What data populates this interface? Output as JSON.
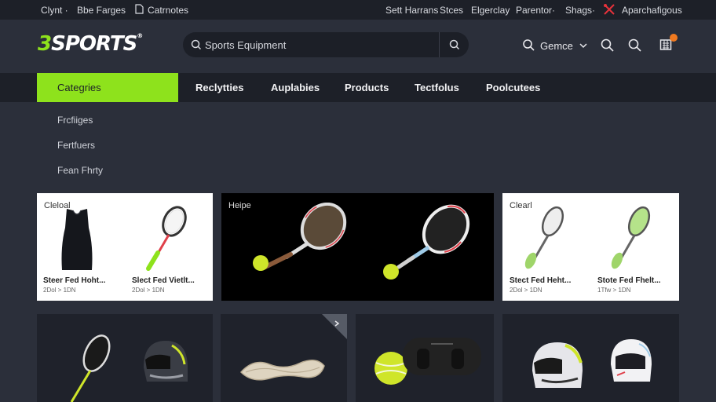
{
  "topbar": {
    "left_items": [
      "Clynt ·",
      "Bbe Farges",
      "Catrnotes"
    ],
    "right_items": [
      "Sett Harrans",
      "Stces",
      "Elgerclay",
      "Parentor·",
      "Shags·",
      "Aparchafigous"
    ]
  },
  "header": {
    "logo_prefix": "3",
    "logo_text": "SPORTS",
    "logo_mark": "®",
    "search_placeholder": "Sports Equipment",
    "account_label": "Gemce"
  },
  "nav": {
    "categories_label": "Categries",
    "items": [
      "Reclytties",
      "Auplabies",
      "Products",
      "Tectfolus",
      "Poolcutees"
    ]
  },
  "dropdown": {
    "items": [
      "Frcfiiges",
      "Fertfuers",
      "Fean Fhrty"
    ]
  },
  "cards_row1": [
    {
      "label": "Cleloal",
      "products": [
        {
          "title": "Steer Fed Hoht...",
          "price": "2Dol > 1DN"
        },
        {
          "title": "Slect Fed Vietlt...",
          "price": "2Dol > 1DN"
        }
      ]
    },
    {
      "label": "Heipe"
    },
    {
      "label": "Clearl",
      "products": [
        {
          "title": "Stect Fed Heht...",
          "price": "2Dol > 1DN"
        },
        {
          "title": "Stote Fed Fhelt...",
          "price": "1Tfw > 1DN"
        }
      ]
    }
  ],
  "colors": {
    "accent": "#8ee21c",
    "background": "#2b2f3a",
    "bar": "#1d2028",
    "badge": "#f07a20",
    "cart_icon": "#e5323b"
  },
  "icons": [
    "search-icon",
    "document-icon",
    "tools-icon",
    "chevron-down-icon",
    "cart-icon",
    "tennis-racket-icon",
    "tennis-ball-icon",
    "helmet-icon",
    "rope-icon"
  ]
}
